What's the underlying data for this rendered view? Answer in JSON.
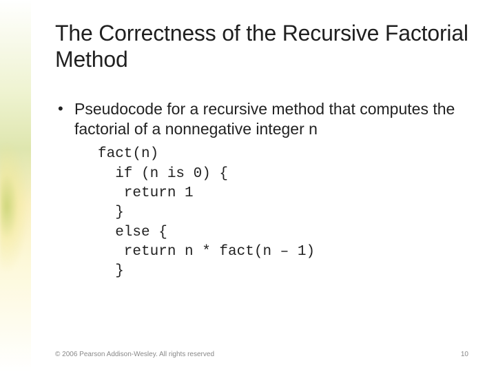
{
  "slide": {
    "title": "The Correctness of the Recursive Factorial Method",
    "bullet": "Pseudocode for a recursive method that computes the factorial of a nonnegative integer n",
    "code": "fact(n)\n  if (n is 0) {\n   return 1\n  }\n  else {\n   return n * fact(n – 1)\n  }"
  },
  "footer": {
    "copyright": "© 2006 Pearson Addison-Wesley. All rights reserved",
    "page": "10"
  }
}
